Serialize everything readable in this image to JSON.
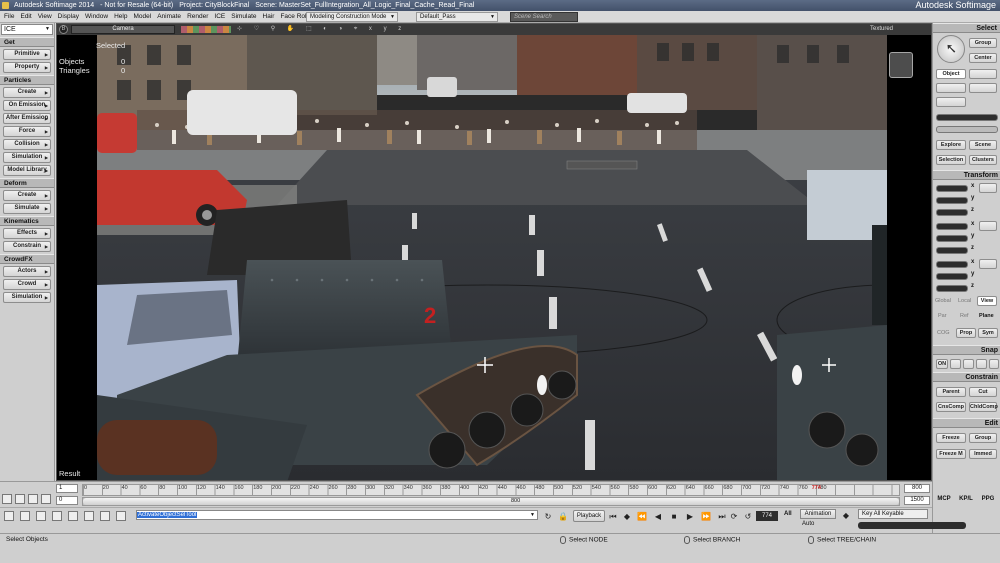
{
  "window": {
    "title_app": "Autodesk Softimage 2014",
    "title_license": "- Not for Resale (64-bit)",
    "title_project": "Project: CityBlockFinal",
    "title_scene": "Scene: MasterSet_FullIntegration_All_Logic_Final_Cache_Read_Final",
    "brand": "Autodesk Softimage"
  },
  "menubar": {
    "items": [
      "File",
      "Edit",
      "View",
      "Display",
      "Window",
      "Help",
      "Model",
      "Animate",
      "Render",
      "ICE",
      "Simulate",
      "Hair",
      "Face Robot"
    ],
    "construction_mode": "Modeling Construction Mode",
    "pass": "Default_Pass",
    "search_placeholder": "Scene Search"
  },
  "left_panel": {
    "toolbar": "ICE",
    "sections": [
      {
        "header": "Get",
        "buttons": [
          "Primitive",
          "Property"
        ]
      },
      {
        "header": "Particles",
        "buttons": [
          "Create",
          "On Emission",
          "After Emission",
          "Force",
          "Collision",
          "Simulation",
          "Model Library"
        ]
      },
      {
        "header": "Deform",
        "buttons": [
          "Create",
          "Simulate"
        ]
      },
      {
        "header": "Kinematics",
        "buttons": [
          "Effects",
          "Constrain"
        ]
      },
      {
        "header": "CrowdFX",
        "buttons": [
          "Actors",
          "Crowd",
          "Simulation"
        ]
      }
    ]
  },
  "viewport": {
    "view_letter": "B",
    "camera": "Camera",
    "display_mode": "Textured",
    "selected_label": "Selected",
    "objects_label": "Objects",
    "objects_value": "0",
    "triangles_label": "Triangles",
    "triangles_value": "0",
    "result_label": "Result",
    "tank_number": "2"
  },
  "right_panel": {
    "select_header": "Select",
    "group": "Group",
    "center": "Center",
    "object": "Object",
    "explore": "Explore",
    "scene": "Scene",
    "selection": "Selection",
    "clusters": "Clusters",
    "transform_header": "Transform",
    "axes": [
      "x",
      "y",
      "z"
    ],
    "global": "Global",
    "local": "Local",
    "view": "View",
    "par": "Par",
    "ref": "Ref",
    "plane": "Plane",
    "cog": "COG",
    "prop": "Prop",
    "sym": "Sym",
    "snap_header": "Snap",
    "on": "ON",
    "constrain_header": "Constrain",
    "parent": "Parent",
    "cut": "Cut",
    "cnscomp": "CnsComp",
    "chldcomp": "ChldComp",
    "edit_header": "Edit",
    "freeze": "Freeze",
    "edit_group": "Group",
    "freeze_m": "Freeze M",
    "immed": "Immed"
  },
  "timeline": {
    "start": "1",
    "start_range": "0",
    "ticks": [
      "0",
      "20",
      "40",
      "60",
      "80",
      "100",
      "120",
      "140",
      "160",
      "180",
      "200",
      "220",
      "240",
      "260",
      "280",
      "300",
      "320",
      "340",
      "360",
      "380",
      "400",
      "420",
      "440",
      "460",
      "480",
      "500",
      "520",
      "540",
      "560",
      "580",
      "600",
      "620",
      "640",
      "660",
      "680",
      "700",
      "720",
      "740",
      "760",
      "780"
    ],
    "range_mid": "800",
    "current_marker": "774",
    "end": "800",
    "end_range": "1500"
  },
  "bottom": {
    "command": "ActivateObjectSelTool",
    "playback": "Playback",
    "frame": "774",
    "all": "All",
    "animation": "Animation",
    "auto": "Auto",
    "key_label": "Key All Keyable",
    "modes": [
      "MCP",
      "KP/L",
      "PPG"
    ]
  },
  "status": {
    "left": "Select Objects",
    "node": "Select NODE",
    "branch": "Select BRANCH",
    "tree": "Select TREE/CHAIN"
  },
  "colors": {
    "title_bg": "#4d5c77",
    "command_highlight": "#2f6fd6",
    "timeline_marker": "#d02020"
  }
}
